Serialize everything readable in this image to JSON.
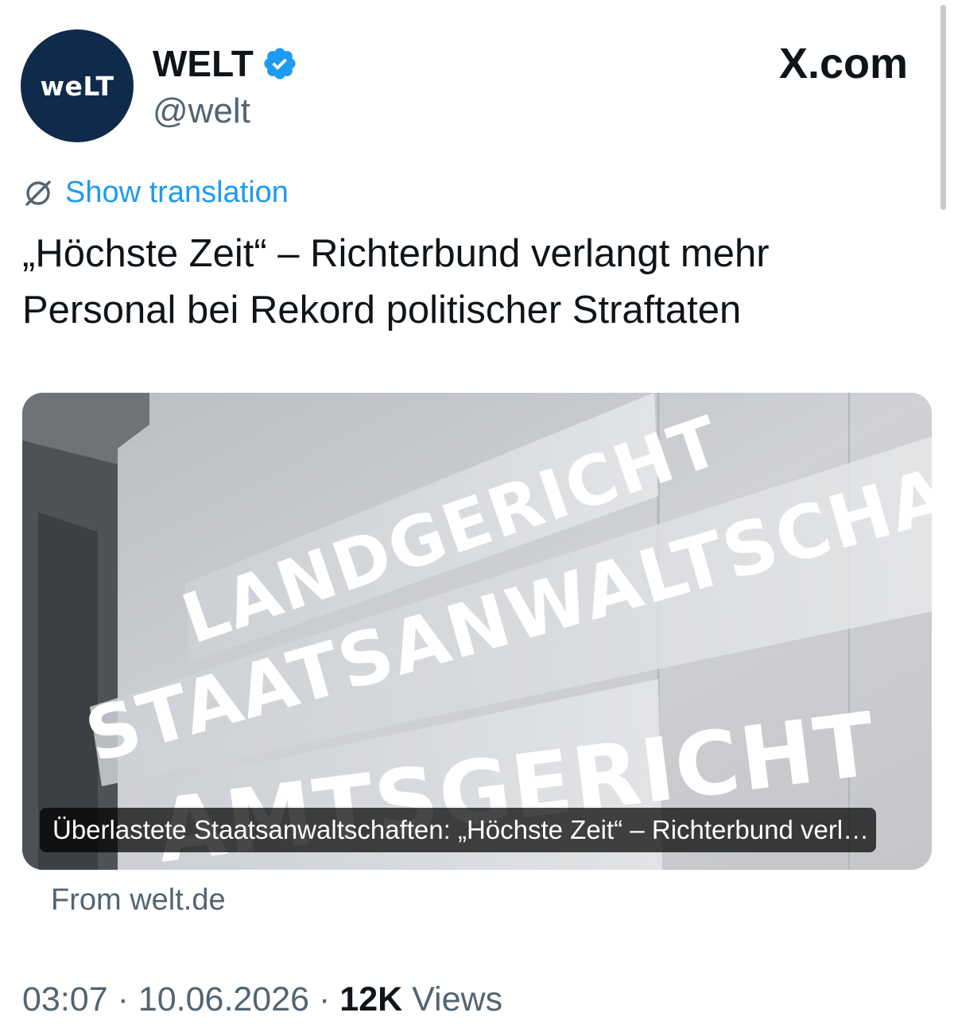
{
  "author": {
    "avatar_text": "weLT",
    "display_name": "WELT",
    "handle": "@welt",
    "verified_icon": "verified-badge-icon"
  },
  "source_brand": "X.com",
  "translation": {
    "label": "Show translation",
    "icon": "translate-globe-icon"
  },
  "tweet_text": "„Höchste Zeit“ – Richterbund verlangt mehr Personal bei Rekord politischer Straftaten",
  "card": {
    "sign_lines": [
      "LANDGERICHT",
      "STAATSANWALTSCHAFT",
      "AMTSGERICHT"
    ],
    "caption": "Überlastete Staatsanwaltschaften: „Höchste Zeit“ – Richterbund verlangt mehr Personal bei Rekord politischer Straftaten",
    "from": "From welt.de"
  },
  "meta": {
    "time": "03:07",
    "separator": "·",
    "date": "10.06.2026",
    "views_count": "12K",
    "views_label": "Views"
  },
  "colors": {
    "link": "#1d9bf0",
    "secondary_text": "#536471",
    "avatar_bg": "#0f2a4a"
  }
}
